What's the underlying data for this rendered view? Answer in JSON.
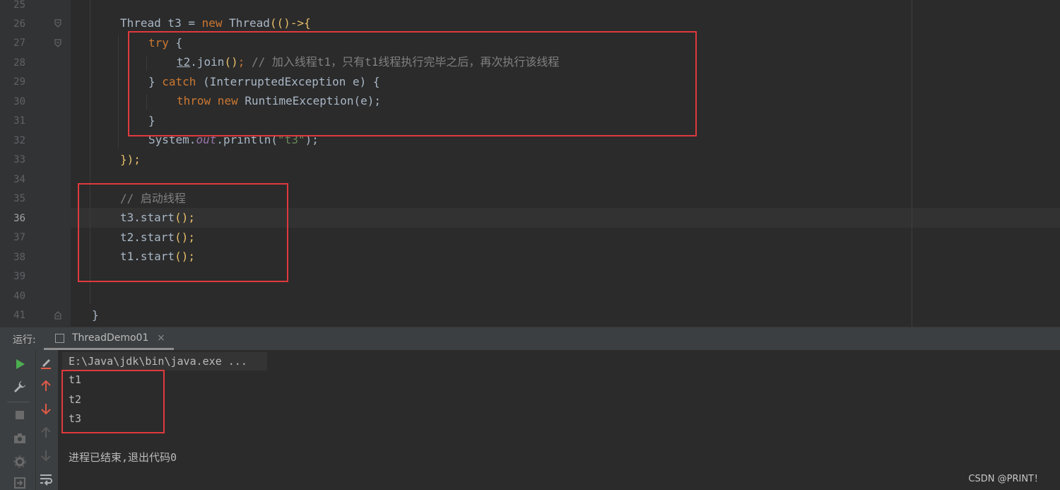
{
  "editor": {
    "line_numbers": [
      "25",
      "26",
      "27",
      "28",
      "29",
      "30",
      "31",
      "32",
      "33",
      "34",
      "35",
      "36",
      "37",
      "38",
      "39",
      "40",
      "41"
    ],
    "current_line": "36",
    "code": {
      "l26_a": "Thread t3 = ",
      "l26_new": "new",
      "l26_b": " Thread",
      "l26_c": "(()->{",
      "l27_try": "try",
      "l27_brace": " {",
      "l28_t2": "t2",
      "l28_join": ".join",
      "l28_paren": "()",
      "l28_semi": ";",
      "l28_comment": " // 加入线程t1，只有t1线程执行完毕之后，再次执行该线程",
      "l29_close": "} ",
      "l29_catch": "catch",
      "l29_rest": " (InterruptedException e) {",
      "l30_throw": "throw",
      "l30_new": " new",
      "l30_rest": " RuntimeException(e);",
      "l31_close": "}",
      "l32_a": "System.",
      "l32_out": "out",
      "l32_b": ".println(",
      "l32_str": "\"t3\"",
      "l32_c": ");",
      "l33": "});",
      "l35_comment": "// 启动线程",
      "l36": "t3.start",
      "l36_p": "();",
      "l37": "t2.start",
      "l37_p": "();",
      "l38": "t1.start",
      "l38_p": "();",
      "l41": "}"
    }
  },
  "run_panel": {
    "label": "运行:",
    "tab_title": "ThreadDemo01",
    "tab_close": "×",
    "command": "E:\\Java\\jdk\\bin\\java.exe ...",
    "output_lines": [
      "t1",
      "t2",
      "t3"
    ],
    "exit_message": "进程已结束,退出代码0"
  },
  "watermark": "CSDN @PRINT！",
  "colors": {
    "annotation_box": "#e0393e",
    "run_icon": "#4caf50",
    "arrow_icon": "#e05a47"
  }
}
